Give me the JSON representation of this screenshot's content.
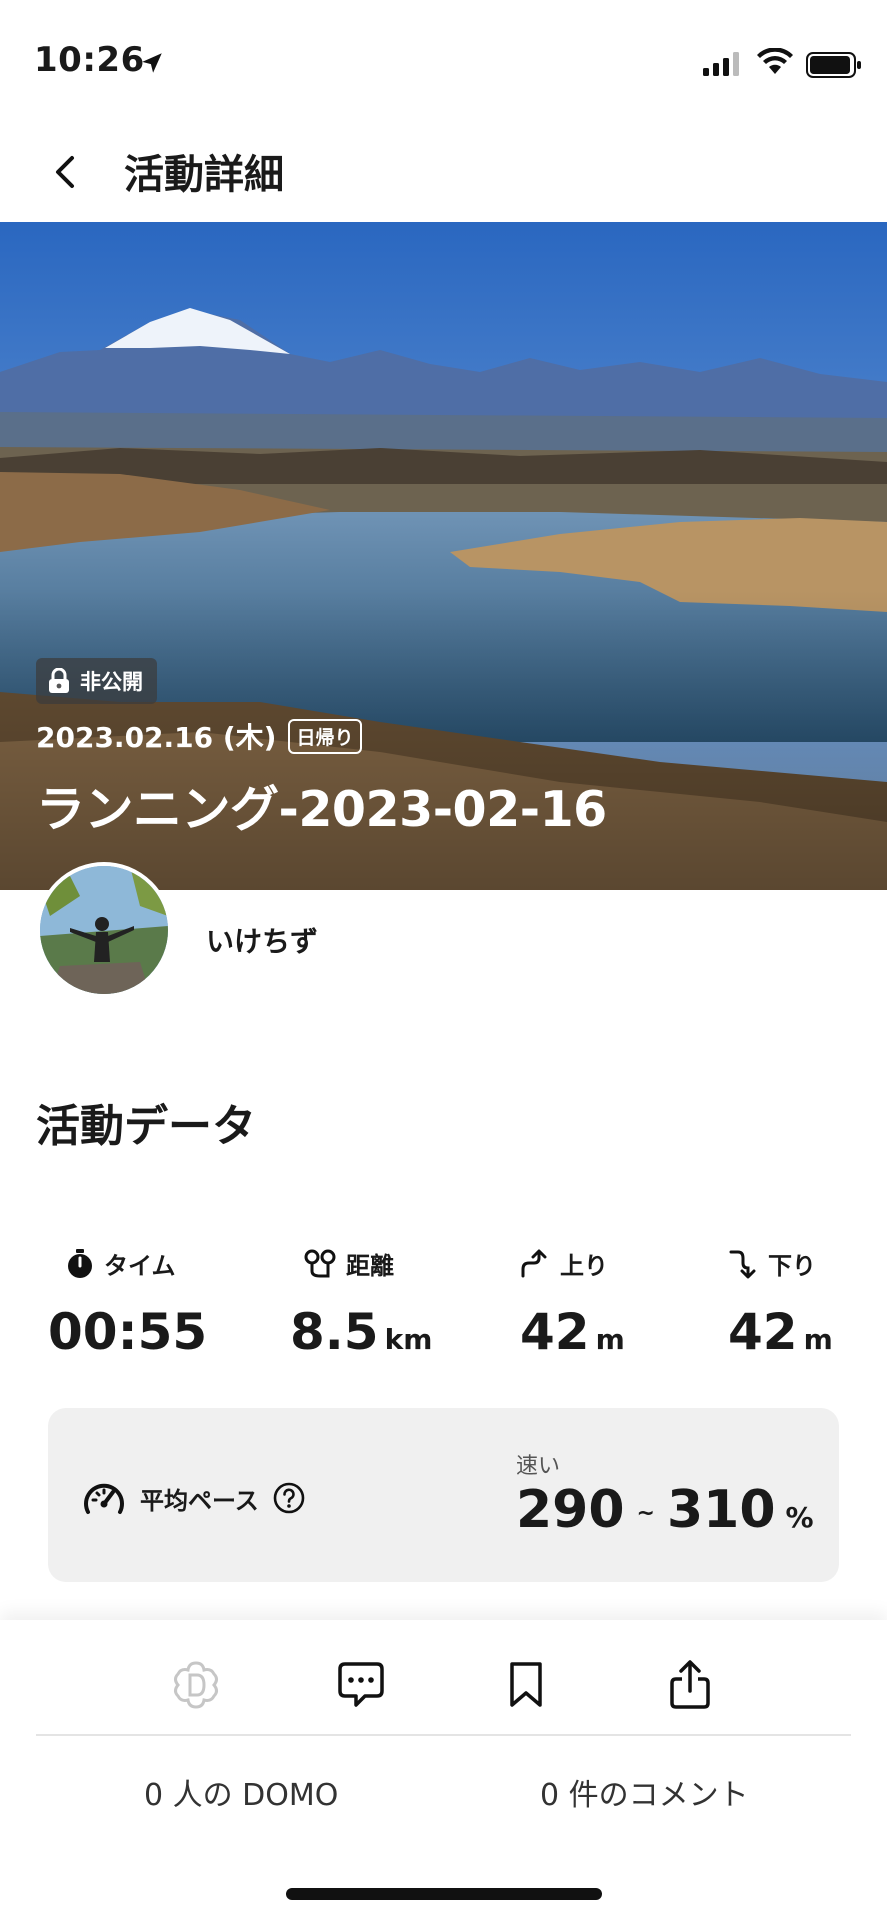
{
  "status_bar": {
    "time": "10:26"
  },
  "nav": {
    "title": "活動詳細"
  },
  "hero": {
    "visibility": "非公開",
    "date": "2023.02.16 (木)",
    "day_type": "日帰り",
    "title": "ランニング-2023-02-16"
  },
  "user": {
    "name": "いけちず"
  },
  "section": {
    "title": "活動データ"
  },
  "stats": [
    {
      "label": "タイム",
      "value": "00:55",
      "unit": "",
      "icon": "stopwatch-icon"
    },
    {
      "label": "距離",
      "value": "8.5",
      "unit": "km",
      "icon": "route-icon"
    },
    {
      "label": "上り",
      "value": "42",
      "unit": "m",
      "icon": "ascent-icon"
    },
    {
      "label": "下り",
      "value": "42",
      "unit": "m",
      "icon": "descent-icon"
    }
  ],
  "pace": {
    "label": "平均ペース",
    "speed_word": "速い",
    "low": "290",
    "high": "310",
    "unit": "%"
  },
  "bottom": {
    "domo_count": "0 人の DOMO",
    "comment_count": "0 件のコメント"
  },
  "colors": {
    "sky": "#2f6fc0",
    "water": "#3d6e96",
    "text": "#1a1a1a",
    "card": "#f0f0f0"
  }
}
